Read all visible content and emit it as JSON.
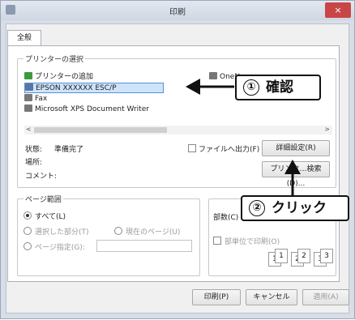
{
  "window": {
    "title": "印刷",
    "close": "×"
  },
  "tab": {
    "label": "全般"
  },
  "printer_group": {
    "legend": "プリンターの選択",
    "items": [
      {
        "label": "プリンターの追加"
      },
      {
        "label": "EPSON XXXXXX ESC/P"
      },
      {
        "label": "Fax"
      },
      {
        "label": "Microsoft XPS Document Writer"
      },
      {
        "label": "OneN"
      }
    ],
    "scroll_left": "<",
    "scroll_right": ">",
    "status_label": "状態:",
    "status_value": "準備完了",
    "location_label": "場所:",
    "comment_label": "コメント:",
    "print_to_file": "ファイルへ出力(F)",
    "preferences_button": "詳細設定(R)",
    "find_printer_button": "プリンタ…検索(D)..."
  },
  "range_group": {
    "legend": "ページ範囲",
    "all": "すべて(L)",
    "selection": "選択した部分(T)",
    "current_page": "現在のページ(U)",
    "pages": "ページ指定(G):"
  },
  "copies": {
    "label": "部数(C)",
    "collate": "部単位で印刷(O)",
    "stack_labels": [
      "1",
      "1",
      "2",
      "2",
      "3",
      "3"
    ]
  },
  "buttons": {
    "print": "印刷(P)",
    "cancel": "キャンセル",
    "apply": "適用(A)"
  },
  "callouts": {
    "confirm": {
      "num": "①",
      "text": "確認"
    },
    "click": {
      "num": "②",
      "text": "クリック"
    }
  },
  "colors": {
    "accent": "#2a6fd6",
    "close": "#c94646",
    "selection": "#cde4fb"
  }
}
